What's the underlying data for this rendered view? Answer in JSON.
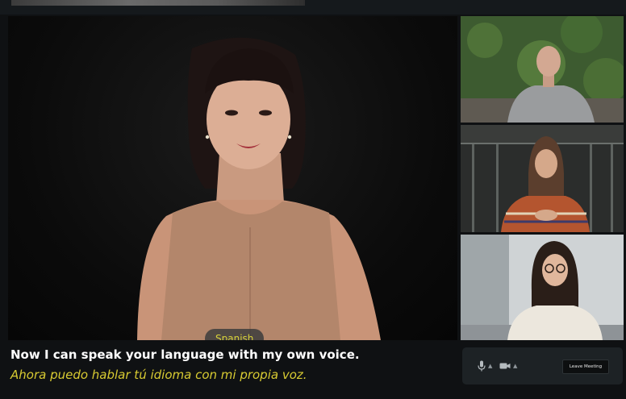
{
  "main_speaker": {
    "language_badge": "Spanish"
  },
  "captions": {
    "original": "Now I can speak your language with my own voice.",
    "translated": "Ahora puedo hablar tú idioma con mi propia voz."
  },
  "controls": {
    "mic_icon": "microphone-icon",
    "camera_icon": "video-camera-icon",
    "leave_label": "Leave Meeting"
  },
  "colors": {
    "translated_caption": "#d8cb32",
    "badge_text": "#d8d23a",
    "background": "#0f1113"
  }
}
